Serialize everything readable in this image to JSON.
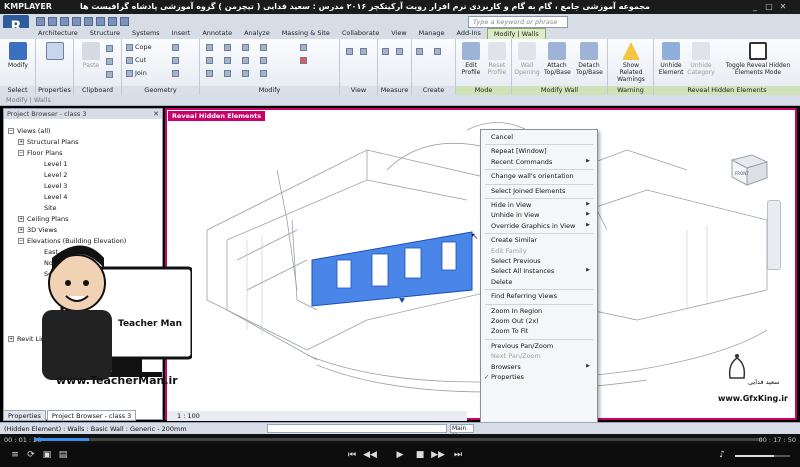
{
  "player": {
    "logo": "KMPLAYER",
    "title": "مجموعه آموزشی جامع ، گام به گام و کاربردی نرم افزار رویت آرکیتکچر ۲۰۱۶ مدرس : سعید فدایی ( تیچرمن ) گروه آموزشی پادشاه گرافیست ها",
    "time_current": "00 : 01 : 20",
    "time_total": "00 : 17 : 50",
    "progress_fraction": 0.075,
    "volume_fraction": 0.7
  },
  "revit": {
    "search_placeholder": "Type a keyword or phrase",
    "tabs": [
      "Architecture",
      "Structure",
      "Systems",
      "Insert",
      "Annotate",
      "Analyze",
      "Massing & Site",
      "Collaborate",
      "View",
      "Manage",
      "Add-Ins",
      "Modify | Walls"
    ],
    "active_tab": "Modify | Walls",
    "ribbon": {
      "select": {
        "button": "Modify",
        "label": "Select"
      },
      "properties": {
        "button": "Properties",
        "label": "Properties"
      },
      "clipboard": {
        "paste": "Paste",
        "label": "Clipboard"
      },
      "geometry": {
        "cope": "Cope",
        "cut": "Cut",
        "join": "Join",
        "label": "Geometry"
      },
      "modify": {
        "label": "Modify"
      },
      "view": {
        "label": "View"
      },
      "measure": {
        "label": "Measure"
      },
      "create": {
        "label": "Create"
      },
      "mode": {
        "edit_profile": "Edit Profile",
        "reset_profile": "Reset Profile",
        "label": "Mode"
      },
      "modify_wall": {
        "wall_opening": "Wall Opening",
        "attach": "Attach Top/Base",
        "detach": "Detach Top/Base",
        "label": "Modify Wall"
      },
      "warning": {
        "show_related": "Show Related Warnings",
        "label": "Warning"
      },
      "reveal": {
        "unhide_element": "Unhide Element",
        "unhide_category": "Unhide Category",
        "toggle": "Toggle Reveal Hidden Elements Mode",
        "label": "Reveal Hidden Elements"
      }
    },
    "options_bar": "Modify | Walls",
    "project_browser": {
      "title": "Project Browser - class 3",
      "items": [
        {
          "label": "Views (all)",
          "toggle": "-"
        },
        {
          "label": "Structural Plans",
          "toggle": "+"
        },
        {
          "label": "Floor Plans",
          "toggle": "-"
        },
        {
          "label": "Level 1"
        },
        {
          "label": "Level 2"
        },
        {
          "label": "Level 3"
        },
        {
          "label": "Level 4"
        },
        {
          "label": "Site"
        },
        {
          "label": "Ceiling Plans",
          "toggle": "+"
        },
        {
          "label": "3D Views",
          "toggle": "+"
        },
        {
          "label": "Elevations (Building Elevation)",
          "toggle": "-"
        },
        {
          "label": "East"
        },
        {
          "label": "North"
        },
        {
          "label": "South"
        },
        {
          "label": "Revit Links",
          "toggle": "+"
        }
      ],
      "bottom_tabs": [
        "Properties",
        "Project Browser - class 3"
      ]
    },
    "view": {
      "mode_label": "Reveal Hidden Elements",
      "scale": "1 : 100",
      "viewcube_label": "FRONT"
    },
    "context_menu": [
      {
        "label": "Cancel"
      },
      {
        "sep": true
      },
      {
        "label": "Repeat [Window]"
      },
      {
        "label": "Recent Commands",
        "submenu": true
      },
      {
        "sep": true
      },
      {
        "label": "Change wall's orientation"
      },
      {
        "sep": true
      },
      {
        "label": "Select Joined Elements"
      },
      {
        "sep": true
      },
      {
        "label": "Hide in View",
        "submenu": true
      },
      {
        "label": "Unhide in View",
        "submenu": true
      },
      {
        "label": "Override Graphics in View",
        "submenu": true
      },
      {
        "sep": true
      },
      {
        "label": "Create Similar"
      },
      {
        "label": "Edit Family",
        "disabled": true
      },
      {
        "label": "Select Previous"
      },
      {
        "label": "Select All Instances",
        "submenu": true
      },
      {
        "label": "Delete"
      },
      {
        "sep": true
      },
      {
        "label": "Find Referring Views"
      },
      {
        "sep": true
      },
      {
        "label": "Zoom In Region"
      },
      {
        "label": "Zoom Out (2x)"
      },
      {
        "label": "Zoom To Fit"
      },
      {
        "sep": true
      },
      {
        "label": "Previous Pan/Zoom"
      },
      {
        "label": "Next Pan/Zoom",
        "disabled": true
      },
      {
        "label": "Browsers",
        "submenu": true
      },
      {
        "label": "Properties",
        "checked": true
      }
    ],
    "status_bar": {
      "text": "(Hidden Element) : Walls : Basic Wall : Generic - 200mm",
      "main_model": "Main M"
    }
  },
  "watermarks": {
    "teacherman_brand": "Teacher Man",
    "teacherman_url": "www.TeacherMan.ir",
    "gfx_name": "سعید فدایی",
    "gfx_url": "www.GfxKing.ir"
  },
  "colors": {
    "accent_magenta": "#c8006a",
    "selection_blue": "#3d7de0",
    "ribbon_bg": "#e5eaf2",
    "context_tab_green": "#d9ecc6"
  }
}
